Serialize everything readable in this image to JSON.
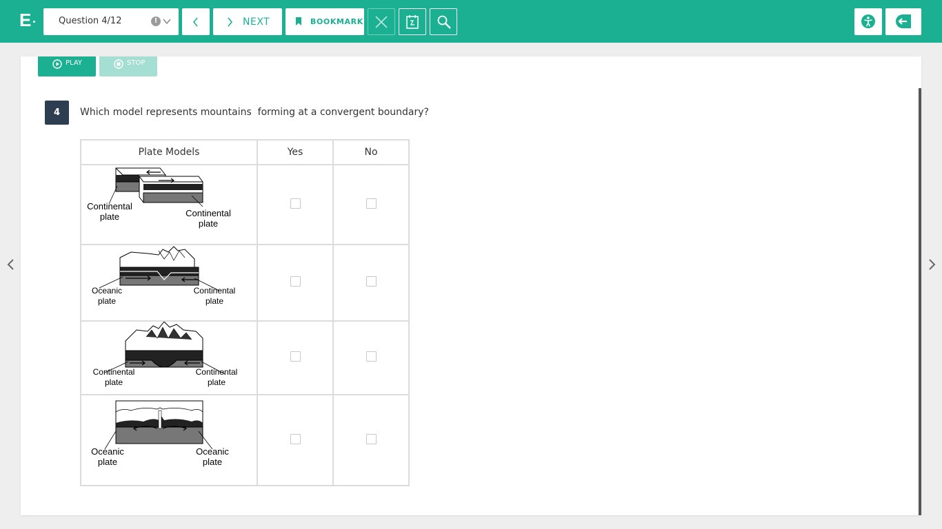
{
  "header": {
    "logo_letter": "E",
    "question_select": "Question 4/12",
    "next_label": "NEXT",
    "bookmark_label": "BOOKMARK"
  },
  "player": {
    "play_label": "PLAY",
    "stop_label": "STOP"
  },
  "question": {
    "number": "4",
    "text": "Which model represents mountains  forming at a convergent boundary?"
  },
  "table": {
    "headers": [
      "Plate Models",
      "Yes",
      "No"
    ],
    "rows": [
      {
        "left_label": "Continental plate",
        "left_l1": "Continental",
        "left_l2": "plate",
        "right_l1": "Continental",
        "right_l2": "plate",
        "yes_checked": false,
        "no_checked": false
      },
      {
        "left_l1": "Oceanic",
        "left_l2": "plate",
        "right_l1": "Continental",
        "right_l2": "plate",
        "yes_checked": false,
        "no_checked": false
      },
      {
        "left_l1": "Continental",
        "left_l2": "plate",
        "right_l1": "Continental",
        "right_l2": "plate",
        "yes_checked": false,
        "no_checked": false
      },
      {
        "left_l1": "Oceanic",
        "left_l2": "plate",
        "right_l1": "Oceanic",
        "right_l2": "plate",
        "yes_checked": false,
        "no_checked": false
      }
    ]
  },
  "colors": {
    "brand": "#1cb092",
    "question_badge": "#2d3e50"
  }
}
